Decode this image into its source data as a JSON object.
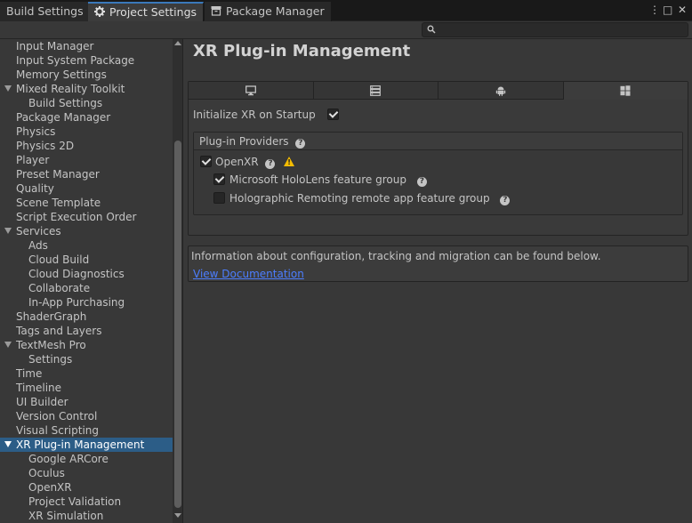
{
  "tabs": [
    {
      "label": "Build Settings",
      "active": false,
      "icon": "none"
    },
    {
      "label": "Project Settings",
      "active": true,
      "icon": "gear-icon"
    },
    {
      "label": "Package Manager",
      "active": false,
      "icon": "package-icon"
    }
  ],
  "window_controls": {
    "menu": "⋮",
    "maximize": "□",
    "close": "✕"
  },
  "search": {
    "placeholder": ""
  },
  "sidebar": {
    "items": [
      {
        "label": "Input Manager",
        "level": 0,
        "foldout": false,
        "selected": false
      },
      {
        "label": "Input System Package",
        "level": 0,
        "foldout": false,
        "selected": false
      },
      {
        "label": "Memory Settings",
        "level": 0,
        "foldout": false,
        "selected": false
      },
      {
        "label": "Mixed Reality Toolkit",
        "level": 0,
        "foldout": true,
        "selected": false
      },
      {
        "label": "Build Settings",
        "level": 1,
        "foldout": false,
        "selected": false
      },
      {
        "label": "Package Manager",
        "level": 0,
        "foldout": false,
        "selected": false
      },
      {
        "label": "Physics",
        "level": 0,
        "foldout": false,
        "selected": false
      },
      {
        "label": "Physics 2D",
        "level": 0,
        "foldout": false,
        "selected": false
      },
      {
        "label": "Player",
        "level": 0,
        "foldout": false,
        "selected": false
      },
      {
        "label": "Preset Manager",
        "level": 0,
        "foldout": false,
        "selected": false
      },
      {
        "label": "Quality",
        "level": 0,
        "foldout": false,
        "selected": false
      },
      {
        "label": "Scene Template",
        "level": 0,
        "foldout": false,
        "selected": false
      },
      {
        "label": "Script Execution Order",
        "level": 0,
        "foldout": false,
        "selected": false
      },
      {
        "label": "Services",
        "level": 0,
        "foldout": true,
        "selected": false
      },
      {
        "label": "Ads",
        "level": 1,
        "foldout": false,
        "selected": false
      },
      {
        "label": "Cloud Build",
        "level": 1,
        "foldout": false,
        "selected": false
      },
      {
        "label": "Cloud Diagnostics",
        "level": 1,
        "foldout": false,
        "selected": false
      },
      {
        "label": "Collaborate",
        "level": 1,
        "foldout": false,
        "selected": false
      },
      {
        "label": "In-App Purchasing",
        "level": 1,
        "foldout": false,
        "selected": false
      },
      {
        "label": "ShaderGraph",
        "level": 0,
        "foldout": false,
        "selected": false
      },
      {
        "label": "Tags and Layers",
        "level": 0,
        "foldout": false,
        "selected": false
      },
      {
        "label": "TextMesh Pro",
        "level": 0,
        "foldout": true,
        "selected": false
      },
      {
        "label": "Settings",
        "level": 1,
        "foldout": false,
        "selected": false
      },
      {
        "label": "Time",
        "level": 0,
        "foldout": false,
        "selected": false
      },
      {
        "label": "Timeline",
        "level": 0,
        "foldout": false,
        "selected": false
      },
      {
        "label": "UI Builder",
        "level": 0,
        "foldout": false,
        "selected": false
      },
      {
        "label": "Version Control",
        "level": 0,
        "foldout": false,
        "selected": false
      },
      {
        "label": "Visual Scripting",
        "level": 0,
        "foldout": false,
        "selected": false
      },
      {
        "label": "XR Plug-in Management",
        "level": 0,
        "foldout": true,
        "selected": true
      },
      {
        "label": "Google ARCore",
        "level": 1,
        "foldout": false,
        "selected": false
      },
      {
        "label": "Oculus",
        "level": 1,
        "foldout": false,
        "selected": false
      },
      {
        "label": "OpenXR",
        "level": 1,
        "foldout": false,
        "selected": false
      },
      {
        "label": "Project Validation",
        "level": 1,
        "foldout": false,
        "selected": false
      },
      {
        "label": "XR Simulation",
        "level": 1,
        "foldout": false,
        "selected": false
      }
    ]
  },
  "main": {
    "title": "XR Plug-in Management",
    "platform_tabs": [
      {
        "icon": "monitor-icon",
        "active": false
      },
      {
        "icon": "server-icon",
        "active": false
      },
      {
        "icon": "android-icon",
        "active": false
      },
      {
        "icon": "windows-icon",
        "active": true
      }
    ],
    "init_on_startup": {
      "label": "Initialize XR on Startup",
      "checked": true
    },
    "providers": {
      "header": "Plug-in Providers",
      "items": [
        {
          "label": "OpenXR",
          "checked": true,
          "help": true,
          "warning": true
        },
        {
          "label": "Microsoft HoloLens feature group",
          "checked": true,
          "help": true,
          "warning": false
        },
        {
          "label": "Holographic Remoting remote app feature group",
          "checked": false,
          "help": true,
          "warning": false
        }
      ]
    },
    "info": {
      "text": "Information about configuration, tracking and migration can be found below.",
      "link": "View Documentation"
    }
  },
  "colors": {
    "background": "#383838",
    "selection": "#2c5d87",
    "accent_tab": "#3a79bb",
    "link": "#4c7eff",
    "warning": "#f4bc02"
  }
}
